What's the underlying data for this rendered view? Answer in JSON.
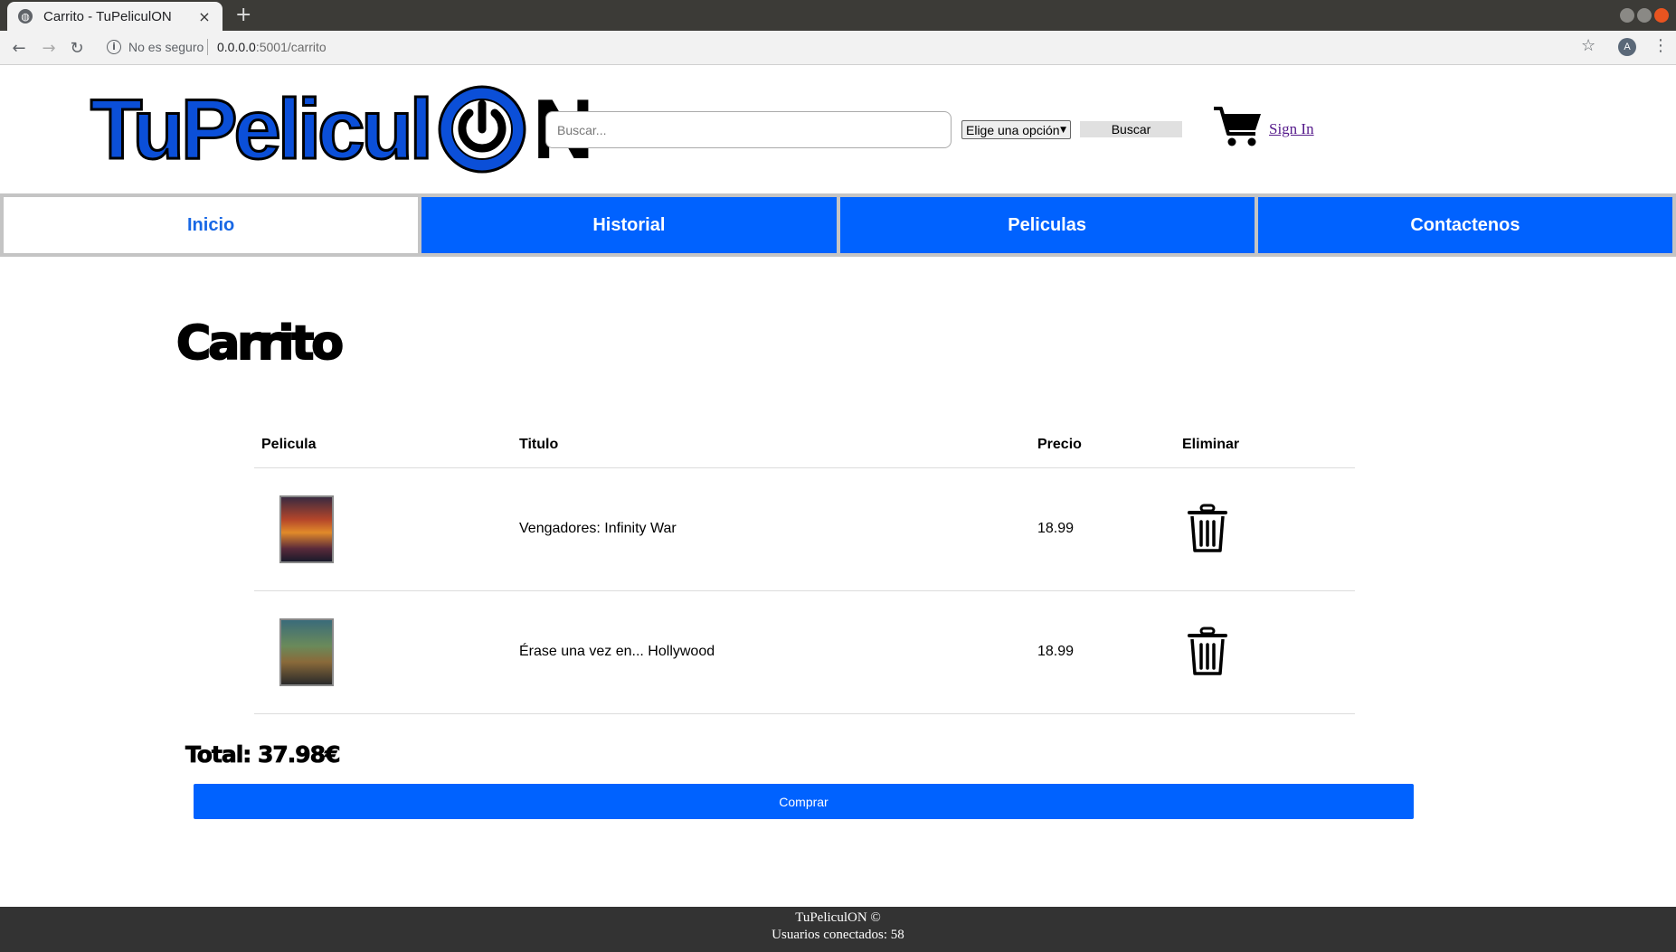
{
  "browser": {
    "tab_title": "Carrito - TuPeliculON",
    "tab_close": "×",
    "new_tab": "+",
    "url_security": "No es seguro",
    "url_host": "0.0.0.0",
    "url_path": ":5001/carrito",
    "avatar_letter": "A"
  },
  "header": {
    "logo_text": "TuPelicul",
    "logo_suffix": "N",
    "search_placeholder": "Buscar...",
    "select_value": "Elige una opción",
    "search_button": "Buscar",
    "signin_label": "Sign In"
  },
  "nav": {
    "items": [
      {
        "label": "Inicio",
        "active": true
      },
      {
        "label": "Historial",
        "active": false
      },
      {
        "label": "Peliculas",
        "active": false
      },
      {
        "label": "Contactenos",
        "active": false
      }
    ]
  },
  "main": {
    "title": "Carrito",
    "table": {
      "headers": [
        "Pelicula",
        "Titulo",
        "Precio",
        "Eliminar"
      ],
      "rows": [
        {
          "title": "Vengadores: Infinity War",
          "price": "18.99"
        },
        {
          "title": "Érase una vez en... Hollywood",
          "price": "18.99"
        }
      ]
    },
    "total": "Total: 37.98€",
    "buy_button": "Comprar"
  },
  "footer": {
    "line1": "TuPeliculON ©",
    "line2": "Usuarios conectados: 58"
  },
  "colors": {
    "brand_blue": "#0062ff",
    "nav_border": "#c4c4c4",
    "footer_bg": "#333333"
  }
}
